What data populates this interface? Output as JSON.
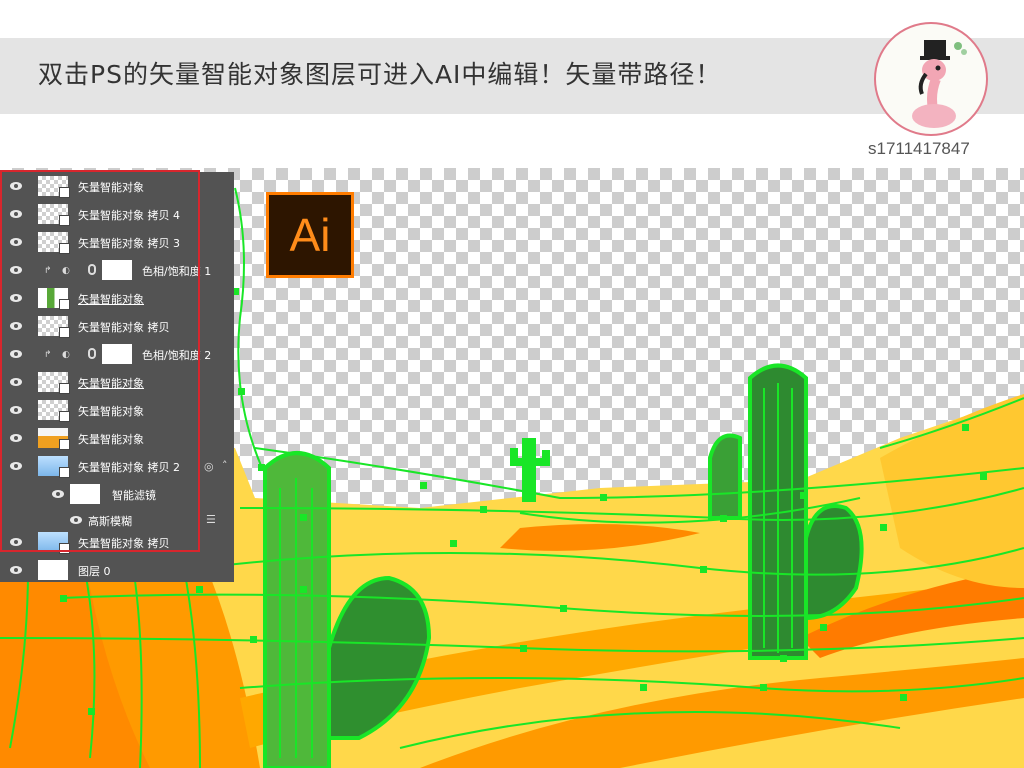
{
  "header": {
    "headline": "双击PS的矢量智能对象图层可进入AI中编辑！矢量带路径！"
  },
  "user": {
    "username": "s1711417847"
  },
  "badge": {
    "ai_label": "Ai"
  },
  "colors": {
    "path_green": "#19e627",
    "sand_yellow": "#ffd84a",
    "sand_orange": "#ff9a00",
    "dune_orange": "#ff7b00",
    "cactus_green": "#58a838",
    "frame_red": "#d8262d",
    "panel_gray": "#535353",
    "ai_orange": "#ff7c00"
  },
  "layers_panel": {
    "layers": [
      {
        "name": "矢量智能对象",
        "thumb": "checker",
        "underlined": false
      },
      {
        "name": "矢量智能对象 拷贝 4",
        "thumb": "checker",
        "underlined": false
      },
      {
        "name": "矢量智能对象 拷贝 3",
        "thumb": "checker",
        "underlined": false
      },
      {
        "name": "色相/饱和度 1",
        "thumb": "adjustment",
        "underlined": false
      },
      {
        "name": "矢量智能对象",
        "thumb": "cactus",
        "underlined": true
      },
      {
        "name": "矢量智能对象 拷贝",
        "thumb": "checker",
        "underlined": false
      },
      {
        "name": "色相/饱和度 2",
        "thumb": "adjustment",
        "underlined": false
      },
      {
        "name": "矢量智能对象",
        "thumb": "checker",
        "underlined": true
      },
      {
        "name": "矢量智能对象",
        "thumb": "checker",
        "underlined": false
      },
      {
        "name": "矢量智能对象",
        "thumb": "desert",
        "underlined": false
      },
      {
        "name": "矢量智能对象 拷贝 2",
        "thumb": "sky",
        "underlined": false
      },
      {
        "name": "智能滤镜",
        "thumb": "white",
        "underlined": false
      },
      {
        "name": "高斯模糊",
        "thumb": "none",
        "underlined": false
      },
      {
        "name": "矢量智能对象 拷贝",
        "thumb": "sky",
        "underlined": false
      },
      {
        "name": "图层 0",
        "thumb": "white",
        "underlined": false
      }
    ]
  }
}
